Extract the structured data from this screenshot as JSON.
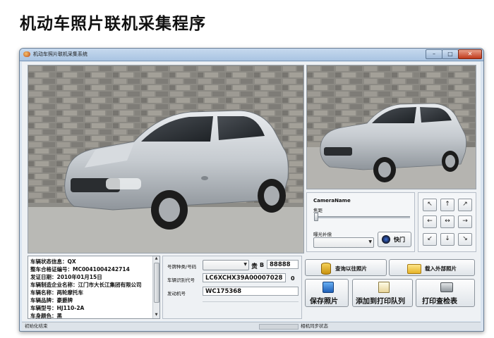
{
  "heading": "机动车照片联机采集程序",
  "window": {
    "title": "机动车照片联机采集系统",
    "minimize": "–",
    "maximize": "□",
    "close": "✕"
  },
  "camera": {
    "name_label": "CameraName",
    "focus_label": "焦距",
    "exposure_label": "曝光补偿",
    "shutter_label": "快门",
    "focus_level": 0.0,
    "exposure_value": ""
  },
  "direction_pad": {
    "up_left": "↖",
    "up": "↑",
    "up_right": "↗",
    "left": "←",
    "center": "↔",
    "right": "→",
    "down_left": "↙",
    "down": "↓",
    "down_right": "↘"
  },
  "vehicle_info": [
    "车辆状态信息：QX",
    "整车合格证编号：MC0041004242714",
    "发证日期：2010年01月15日",
    "车辆制造企业名称：江门市大长江集团有限公司",
    "车辆名称：两轮摩托车",
    "车辆品牌：豪爵牌",
    "车辆型号：HJ110-2A",
    "车身颜色：黑"
  ],
  "plate": {
    "type_label": "号牌种类/号码",
    "type_value": "",
    "province": "贵",
    "letter": "B",
    "number": "88888",
    "vin_label": "车辆识别代号",
    "vin": "LC6XCHX39A00007028",
    "vin_check": "0",
    "engine_label": "发动机号",
    "engine": "WC175368"
  },
  "actions": {
    "query_previous": "查询以往照片",
    "load_external": "载入外部照片",
    "save_photo": "保存照片",
    "add_to_print_queue": "添加到打印队列",
    "print_inspection": "打印查检表"
  },
  "status": {
    "left": "初始化结束",
    "right": "相机同步状态"
  },
  "colors": {
    "titlebar": "#a9c4e2",
    "close_button": "#c0391b",
    "window_bg": "#d9e4f0"
  }
}
